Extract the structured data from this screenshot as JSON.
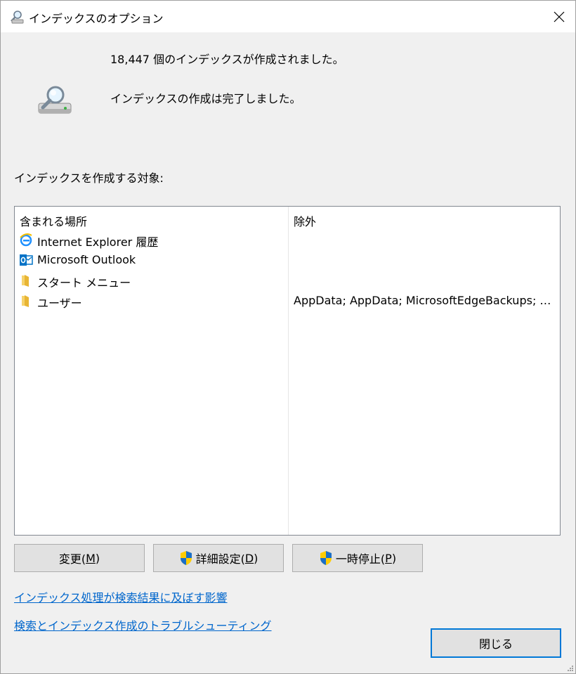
{
  "window": {
    "title": "インデックスのオプション",
    "close_label": "✕"
  },
  "status": {
    "count_text": "18,447 個のインデックスが作成されました。",
    "state_text": "インデックスの作成は完了しました。"
  },
  "section_label": "インデックスを作成する対象:",
  "list": {
    "columns": [
      "含まれる場所",
      "除外"
    ],
    "rows": [
      {
        "location": "Internet Explorer 履歴",
        "exclude": "",
        "icon": "ie-icon"
      },
      {
        "location": "Microsoft Outlook",
        "exclude": "",
        "icon": "outlook-icon"
      },
      {
        "location": "スタート メニュー",
        "exclude": "",
        "icon": "folder-icon"
      },
      {
        "location": "ユーザー",
        "exclude": "AppData; AppData; MicrosoftEdgeBackups; v...",
        "icon": "folder-icon"
      }
    ]
  },
  "buttons": {
    "modify": {
      "text": "変更(",
      "key": "M",
      "end": ")"
    },
    "advanced": {
      "text": "詳細設定(",
      "key": "D",
      "end": ")"
    },
    "pause": {
      "text": "一時停止(",
      "key": "P",
      "end": ")"
    },
    "close": "閉じる"
  },
  "links": {
    "affect": "インデックス処理が検索結果に及ぼす影響",
    "troubleshoot": "検索とインデックス作成のトラブルシューティング"
  },
  "colors": {
    "link": "#0066cc",
    "focus_border": "#0078d7"
  }
}
